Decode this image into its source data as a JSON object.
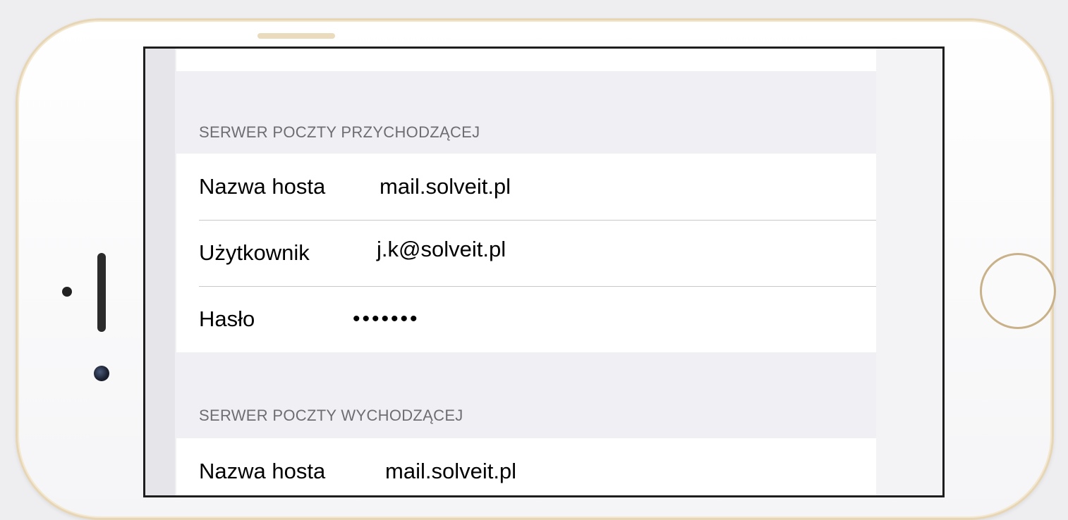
{
  "incoming": {
    "header": "SERWER POCZTY PRZYCHODZĄCEJ",
    "rows": [
      {
        "label": "Nazwa hosta",
        "value": "mail.solveit.pl"
      },
      {
        "label": "Użytkownik",
        "value": "j.k@solveit.pl"
      },
      {
        "label": "Hasło",
        "value": "•••••••"
      }
    ]
  },
  "outgoing": {
    "header": "SERWER POCZTY WYCHODZĄCEJ",
    "rows": [
      {
        "label": "Nazwa hosta",
        "value": "mail.solveit.pl"
      }
    ]
  },
  "colors": {
    "background": "#efeff4",
    "section_header": "#6d6d72",
    "separator": "#c8c7cc",
    "phone_frame": "#e7d6b6"
  }
}
